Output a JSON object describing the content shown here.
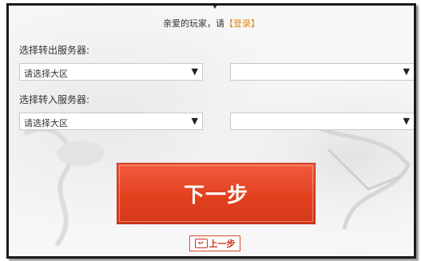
{
  "welcome": {
    "prefix": "亲爱的玩家，请",
    "login_link": "【登录】"
  },
  "from_server": {
    "label": "选择转出服务器:",
    "region_select": {
      "value": "请选择大区"
    },
    "server_select": {
      "value": ""
    }
  },
  "to_server": {
    "label": "选择转入服务器:",
    "region_select": {
      "value": "请选择大区"
    },
    "server_select": {
      "value": ""
    }
  },
  "buttons": {
    "next_label": "下一步",
    "prev_label": "上一步"
  },
  "icons": {
    "dropdown": "triangle-down",
    "back": "return-arrow"
  },
  "colors": {
    "accent": "#e2411f",
    "link": "#e0851a",
    "frame": "#1a1a1a"
  }
}
